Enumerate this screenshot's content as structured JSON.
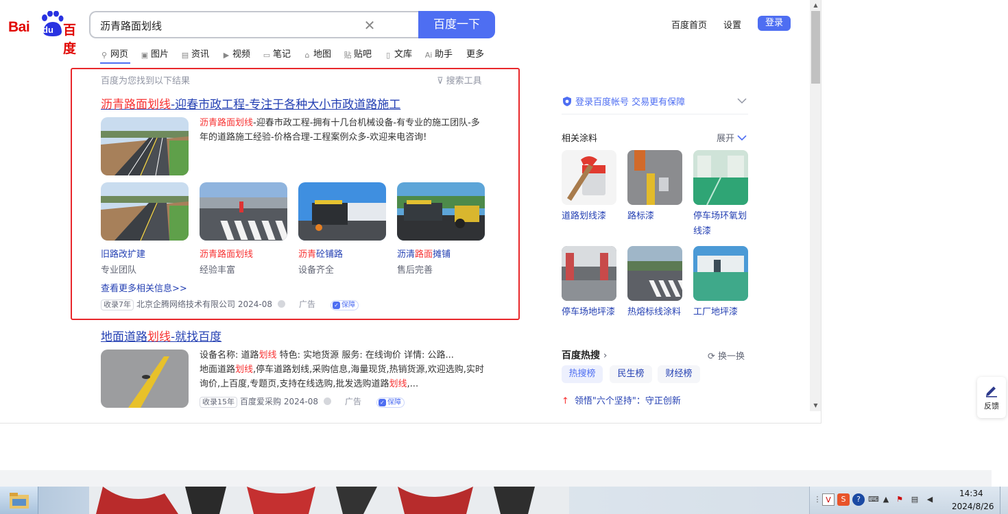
{
  "logo": {
    "bai": "Bai",
    "du": "du",
    "cn": "百度"
  },
  "search": {
    "value": "沥青路面划线",
    "button_label": "百度一下"
  },
  "top_nav": {
    "home_label": "百度首页",
    "settings_label": "设置",
    "login_label": "登录"
  },
  "tabs": [
    {
      "label": "网页",
      "icon": "search-icon"
    },
    {
      "label": "图片",
      "icon": "image-icon"
    },
    {
      "label": "资讯",
      "icon": "news-icon"
    },
    {
      "label": "视频",
      "icon": "video-icon"
    },
    {
      "label": "笔记",
      "icon": "note-icon"
    },
    {
      "label": "地图",
      "icon": "map-icon"
    },
    {
      "label": "贴吧",
      "icon": "tieba-icon"
    },
    {
      "label": "文库",
      "icon": "doc-icon"
    },
    {
      "label": "助手",
      "icon": "ai-icon"
    },
    {
      "label": "更多"
    }
  ],
  "results_header": {
    "count_text": "百度为您找到以下结果",
    "tools_label": "搜索工具"
  },
  "result1": {
    "title_em": "沥青路面划线",
    "title_rest": "-迎春市政工程-专注于各种大小市政道路施工",
    "desc_em": "沥青路面划线",
    "desc_rest": "-迎春市政工程-拥有十几台机械设备-有专业的施工团队-多年的道路施工经验-价格合理-工程案例众多-欢迎来电咨询!",
    "subs": [
      {
        "title_pre": "旧路改扩建",
        "title_em": "",
        "title_post": "",
        "desc": "专业团队"
      },
      {
        "title_pre": "",
        "title_em": "沥青路面划线",
        "title_post": "",
        "desc": "经验丰富"
      },
      {
        "title_pre": "",
        "title_em": "沥青",
        "title_post": "砼铺路",
        "desc": "设备齐全"
      },
      {
        "title_pre": "沥清",
        "title_em": "路面",
        "title_post": "摊铺",
        "desc": "售后完善"
      }
    ],
    "more_link": "查看更多相关信息>>",
    "meta": {
      "years": "收录7年",
      "source": "北京企腾网络技术有限公司",
      "date": "2024-08",
      "ad": "广告",
      "guard": "保障"
    }
  },
  "result2": {
    "title_pre": "地面道路",
    "title_em": "划线",
    "title_post": "-就找百度",
    "line1": "设备名称: 道路",
    "line1_em": "划线",
    "line1_rest": "特色: 实地货源    服务: 在线询价    详情: 公路...",
    "line2_pre": "地面道路",
    "line2_em": "划线",
    "line2_rest": ",停车道路划线,采购信息,海量现货,热销货源,欢迎选购,实时",
    "line3_pre": "询价,上百度,专题页,支持在线选购,批发选购道路",
    "line3_em": "划线",
    "line3_rest": ",...",
    "meta": {
      "years": "收录15年",
      "source": "百度爱采购",
      "date": "2024-08",
      "ad": "广告",
      "guard": "保障"
    }
  },
  "sidebar": {
    "login_tip": "登录百度帐号 交易更有保障",
    "related_title": "相关涂料",
    "expand_label": "展开",
    "related": [
      {
        "label": "道路划线漆"
      },
      {
        "label": "路标漆"
      },
      {
        "label": "停车场环氧划线漆"
      },
      {
        "label": "停车场地坪漆"
      },
      {
        "label": "热熔标线涂料"
      },
      {
        "label": "工厂地坪漆"
      }
    ],
    "hot_title": "百度热搜",
    "refresh_label": "换一换",
    "hot_tabs": [
      "热搜榜",
      "民生榜",
      "财经榜"
    ],
    "hot_item": "领悟\"六个坚持\"：守正创新"
  },
  "feedback": {
    "label": "反馈"
  },
  "taskbar": {
    "time": "14:34",
    "date": "2024/8/26"
  },
  "colors": {
    "brand_blue": "#4e6ef2",
    "link_blue": "#2440b3",
    "highlight_red": "#f73131",
    "box_red": "#e8282b"
  }
}
